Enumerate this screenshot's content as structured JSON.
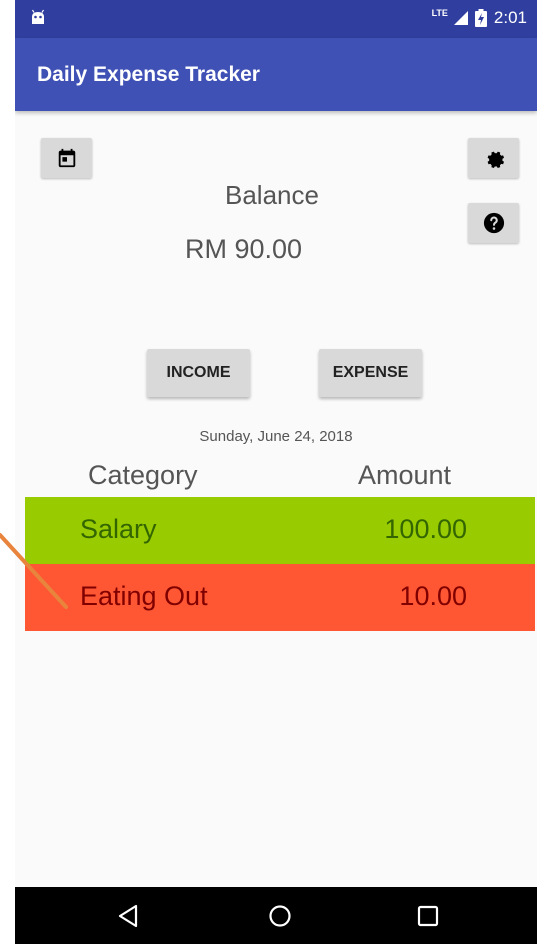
{
  "status_bar": {
    "network_label": "LTE",
    "time": "2:01",
    "bg_color": "#303f9f"
  },
  "app_bar": {
    "title": "Daily Expense Tracker",
    "bg_color": "#3f51b5"
  },
  "toolbar": {
    "calendar_icon": "calendar-icon",
    "settings_icon": "gear-icon",
    "help_icon": "help-icon"
  },
  "balance": {
    "label": "Balance",
    "value": "RM 90.00"
  },
  "actions": {
    "income_label": "INCOME",
    "expense_label": "EXPENSE"
  },
  "date": "Sunday, June 24, 2018",
  "table": {
    "headers": [
      "Category",
      "Amount"
    ],
    "rows": [
      {
        "category": "Salary",
        "amount": "100.00",
        "bg_color": "#99cc00",
        "text_color": "#336600"
      },
      {
        "category": "Eating Out",
        "amount": "10.00",
        "bg_color": "#ff5733",
        "text_color": "#800000"
      }
    ]
  },
  "nav_bar": {
    "back_icon": "back-icon",
    "home_icon": "home-icon",
    "recents_icon": "recents-icon"
  },
  "annotation": {
    "color": "#e8843c"
  }
}
